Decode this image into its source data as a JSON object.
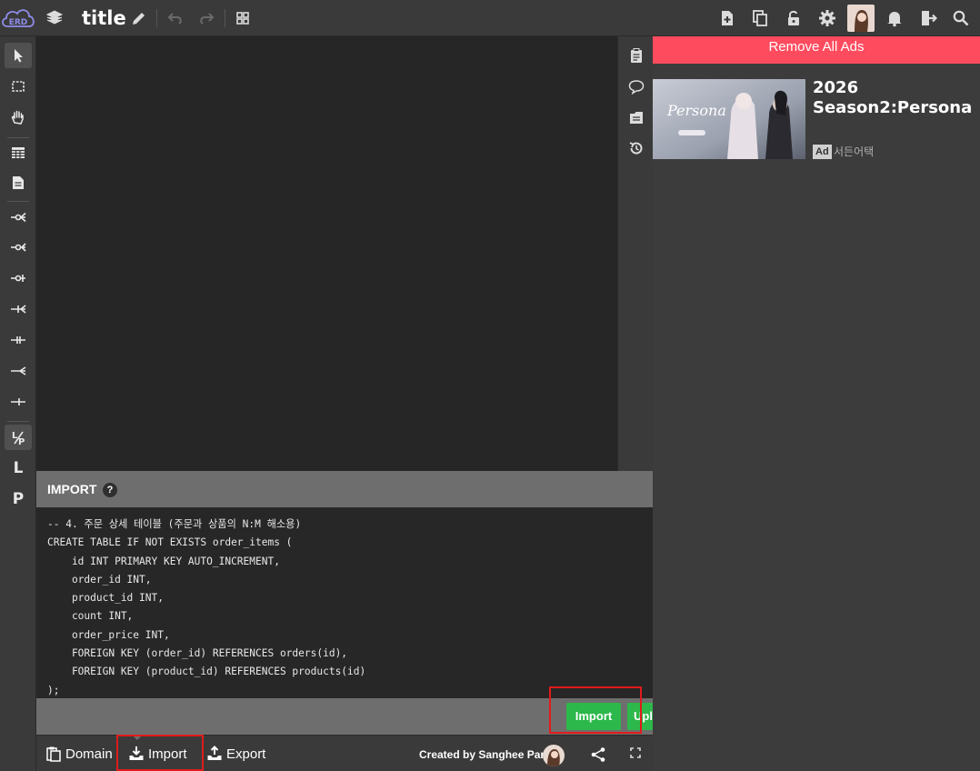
{
  "app": {
    "logo_text": "ERD",
    "title": "title"
  },
  "ads": {
    "remove_label": "Remove All Ads",
    "title": "2026 Season2:Persona",
    "badge": "Ad",
    "sponsor": "서든어택",
    "image_text": "Persona"
  },
  "import_panel": {
    "title": "IMPORT",
    "help": "?",
    "code_lines": [
      "-- 4. 주문 상세 테이블 (주문과 상품의 N:M 해소용)",
      "CREATE TABLE IF NOT EXISTS order_items (",
      "    id INT PRIMARY KEY AUTO_INCREMENT,",
      "    order_id INT,",
      "    product_id INT,",
      "    count INT,",
      "    order_price INT,",
      "    FOREIGN KEY (order_id) REFERENCES orders(id),",
      "    FOREIGN KEY (product_id) REFERENCES products(id)",
      ");"
    ],
    "import_button": "Import",
    "upload_button": "Upl"
  },
  "bottom": {
    "domain_label": "Domain",
    "import_label": "Import",
    "export_label": "Export",
    "credit": "Created by Sanghee Park"
  },
  "colors": {
    "accent_green": "#2db84b",
    "remove_ads_bg": "#ff4b5e",
    "highlight_red": "#e11b1b"
  }
}
